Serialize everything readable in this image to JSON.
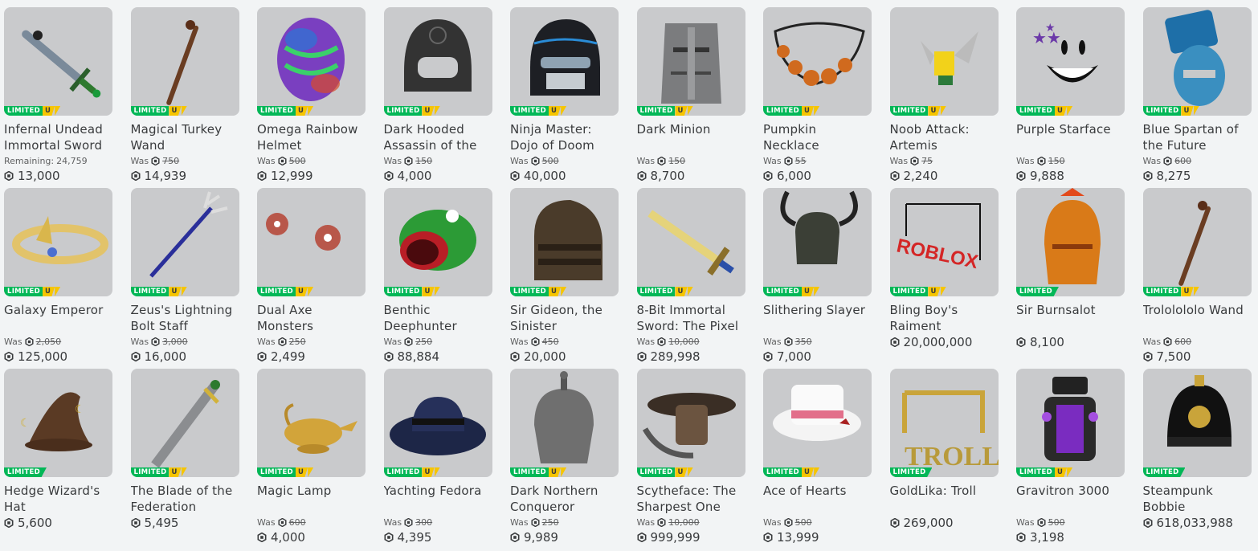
{
  "labels": {
    "limited": "LIMITED",
    "unique": "U",
    "was": "Was",
    "remaining_prefix": "Remaining:"
  },
  "colors": {
    "limited": "#02b757",
    "unique": "#f6c500",
    "thumb_bg": "#c9cacc",
    "page_bg": "#f2f4f5"
  },
  "items": [
    {
      "name": "Infernal Undead Immortal Sword",
      "unique": true,
      "remaining": "24,759",
      "price": "13,000",
      "icon": "sword-icon"
    },
    {
      "name": "Magical Turkey Wand",
      "unique": true,
      "was": "750",
      "price": "14,939",
      "icon": "wand-icon"
    },
    {
      "name": "Omega Rainbow Helmet",
      "unique": true,
      "was": "500",
      "price": "12,999",
      "icon": "helmet-icon"
    },
    {
      "name": "Dark Hooded Assassin of the",
      "unique": true,
      "was": "150",
      "price": "4,000",
      "icon": "hood-icon"
    },
    {
      "name": "Ninja Master: Dojo of Doom",
      "unique": true,
      "was": "500",
      "price": "40,000",
      "icon": "ninja-mask-icon"
    },
    {
      "name": "Dark Minion",
      "unique": true,
      "was": "150",
      "price": "8,700",
      "icon": "knight-helm-icon"
    },
    {
      "name": "Pumpkin Necklace",
      "unique": true,
      "was": "55",
      "price": "6,000",
      "icon": "necklace-icon"
    },
    {
      "name": "Noob Attack: Artemis",
      "unique": true,
      "was": "75",
      "price": "2,240",
      "icon": "flying-noob-icon"
    },
    {
      "name": "Purple Starface",
      "unique": true,
      "was": "150",
      "price": "9,888",
      "icon": "face-icon"
    },
    {
      "name": "Blue Spartan of the Future",
      "unique": true,
      "was": "600",
      "price": "8,275",
      "icon": "spartan-helmet-icon"
    },
    {
      "name": "Galaxy Emperor",
      "unique": true,
      "was": "2,050",
      "price": "125,000",
      "icon": "crown-ring-icon"
    },
    {
      "name": "Zeus's Lightning Bolt Staff",
      "unique": true,
      "was": "3,000",
      "price": "16,000",
      "icon": "staff-icon"
    },
    {
      "name": "Dual Axe Monsters",
      "unique": true,
      "was": "250",
      "price": "2,499",
      "icon": "monsters-icon"
    },
    {
      "name": "Benthic Deephunter",
      "unique": true,
      "was": "250",
      "price": "88,884",
      "icon": "fish-hat-icon"
    },
    {
      "name": "Sir Gideon, the Sinister",
      "unique": true,
      "was": "450",
      "price": "20,000",
      "icon": "dark-helm-icon"
    },
    {
      "name": "8-Bit Immortal Sword: The Pixel",
      "unique": true,
      "was": "10,000",
      "price": "289,998",
      "icon": "pixel-sword-icon"
    },
    {
      "name": "Slithering Slayer",
      "unique": true,
      "was": "350",
      "price": "7,000",
      "icon": "horned-helm-icon"
    },
    {
      "name": "Bling Boy's Raiment",
      "unique": true,
      "price": "20,000,000",
      "icon": "chain-icon",
      "art_text": "ROBLOX"
    },
    {
      "name": "Sir Burnsalot",
      "unique": false,
      "price": "8,100",
      "icon": "gold-helm-icon"
    },
    {
      "name": "Trololololo Wand",
      "unique": true,
      "was": "600",
      "price": "7,500",
      "icon": "wand-icon"
    },
    {
      "name": "Hedge Wizard's Hat",
      "unique": false,
      "price": "5,600",
      "icon": "wizard-hat-icon"
    },
    {
      "name": "The Blade of the Federation",
      "unique": true,
      "price": "5,495",
      "icon": "blade-icon"
    },
    {
      "name": "Magic Lamp",
      "unique": true,
      "was": "600",
      "price": "4,000",
      "icon": "lamp-icon"
    },
    {
      "name": "Yachting Fedora",
      "unique": true,
      "was": "300",
      "price": "4,395",
      "icon": "fedora-icon"
    },
    {
      "name": "Dark Northern Conqueror",
      "unique": true,
      "was": "250",
      "price": "9,989",
      "icon": "spiked-helm-icon"
    },
    {
      "name": "Scytheface: The Sharpest One",
      "unique": true,
      "was": "10,000",
      "price": "999,999",
      "icon": "scythe-mask-icon"
    },
    {
      "name": "Ace of Hearts",
      "unique": true,
      "was": "500",
      "price": "13,999",
      "icon": "top-hat-icon"
    },
    {
      "name": "GoldLika: Troll",
      "unique": false,
      "price": "269,000",
      "icon": "gold-chain-icon",
      "art_text": "TROLL"
    },
    {
      "name": "Gravitron 3000",
      "unique": true,
      "was": "500",
      "price": "3,198",
      "icon": "robot-icon"
    },
    {
      "name": "Steampunk Bobbie",
      "unique": false,
      "price": "618,033,988",
      "icon": "bobbie-helmet-icon"
    }
  ]
}
